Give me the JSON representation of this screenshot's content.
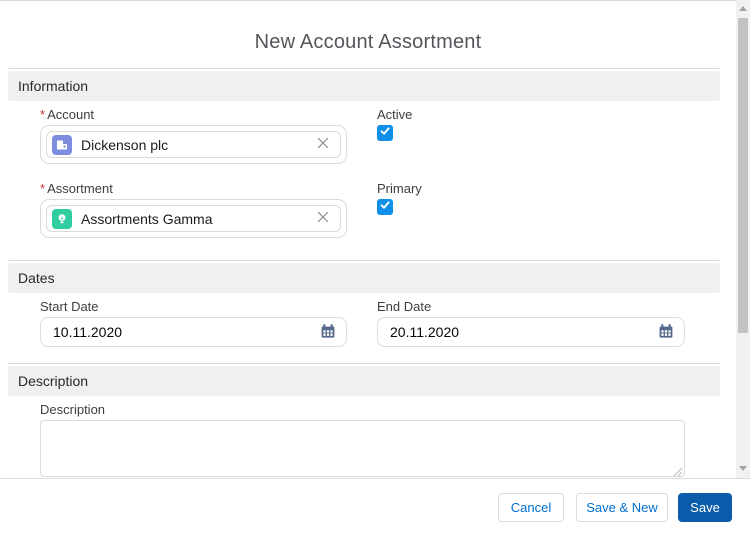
{
  "title": "New Account Assortment",
  "required_marker": "*",
  "sections": {
    "information": {
      "heading": "Information",
      "account": {
        "label": "Account",
        "required": true,
        "value": "Dickenson plc"
      },
      "active": {
        "label": "Active",
        "checked": true
      },
      "assortment": {
        "label": "Assortment",
        "required": true,
        "value": "Assortments Gamma"
      },
      "primary": {
        "label": "Primary",
        "checked": true
      }
    },
    "dates": {
      "heading": "Dates",
      "start_date": {
        "label": "Start Date",
        "value": "10.11.2020"
      },
      "end_date": {
        "label": "End Date",
        "value": "20.11.2020"
      }
    },
    "description": {
      "heading": "Description",
      "field": {
        "label": "Description",
        "value": ""
      }
    }
  },
  "footer": {
    "cancel_label": "Cancel",
    "save_new_label": "Save & New",
    "save_label": "Save"
  },
  "colors": {
    "brand_text": "#0070d2",
    "save_button_bg": "#0b5cab",
    "checkbox_checked": "#0e8fe9",
    "account_icon_bg": "#7f8de1",
    "assortment_icon_bg": "#2fcda0",
    "calendar_icon": "#54698d",
    "required_marker": "#c23934",
    "section_header_bg": "#f0f0f0"
  }
}
